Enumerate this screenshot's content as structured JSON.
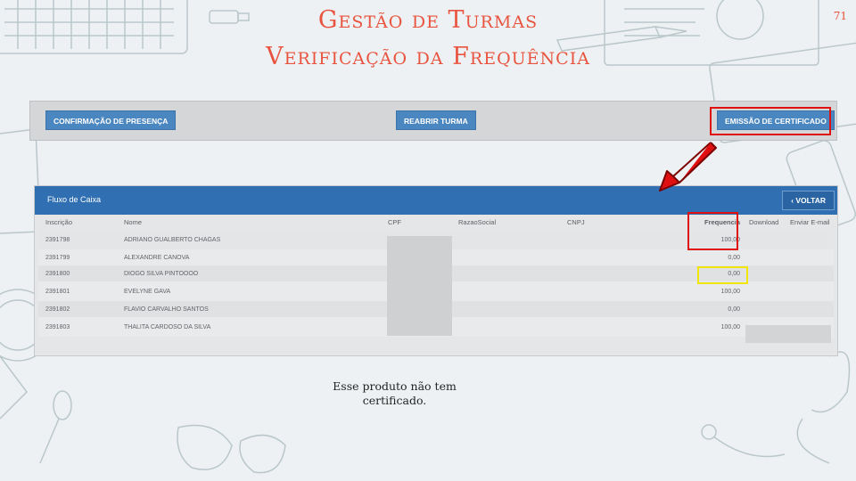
{
  "slide": {
    "title_line1": "Gestão de Turmas",
    "title_line2": "Verificação da Frequência",
    "number": "71",
    "note": "Esse produto  não tem certificado."
  },
  "toolbar": {
    "confirm_label": "CONFIRMAÇÃO DE PRESENÇA",
    "reopen_label": "REABRIR TURMA",
    "certificate_label": "EMISSÃO DE CERTIFICADO"
  },
  "panel": {
    "title": "Fluxo de Caixa",
    "back_label": "VOLTAR",
    "columns": [
      "Inscrição",
      "Nome",
      "CPF",
      "RazaoSocial",
      "CNPJ",
      "Frequencia",
      "Download",
      "Enviar E-mail"
    ],
    "rows": [
      {
        "inscricao": "2391798",
        "nome": "ADRIANO GUALBERTO CHAGAS",
        "frequencia": "100,00"
      },
      {
        "inscricao": "2391799",
        "nome": "ALEXANDRE CANOVA",
        "frequencia": "0,00"
      },
      {
        "inscricao": "2391800",
        "nome": "DIOGO SILVA PINTOOOO",
        "frequencia": "0,00"
      },
      {
        "inscricao": "2391801",
        "nome": "EVELYNE GAVA",
        "frequencia": "100,00"
      },
      {
        "inscricao": "2391802",
        "nome": "FLAVIO CARVALHO SANTOS",
        "frequencia": "0,00"
      },
      {
        "inscricao": "2391803",
        "nome": "THALITA CARDOSO DA SILVA",
        "frequencia": "100,00"
      }
    ]
  },
  "colors": {
    "title": "#e8543f",
    "button": "#4a86c0",
    "panel_header": "#2f6fb2",
    "highlight_red": "#e01010",
    "highlight_yellow": "#f2e600"
  }
}
